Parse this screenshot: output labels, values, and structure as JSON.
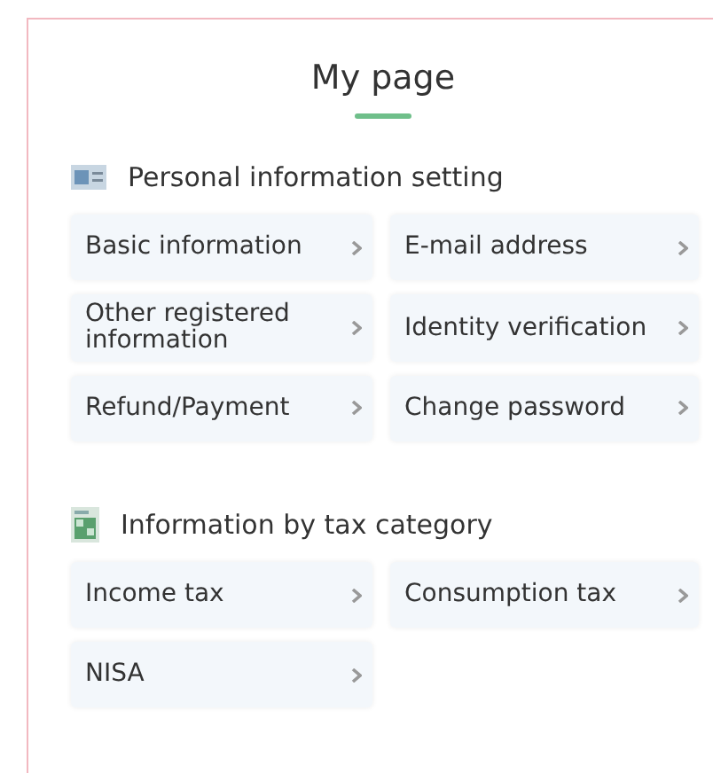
{
  "title": "My page",
  "sections": [
    {
      "kind": "profile",
      "heading": "Personal information setting",
      "links": [
        {
          "label": "Basic information"
        },
        {
          "label": "E-mail address"
        },
        {
          "label": "Other registered information"
        },
        {
          "label": "Identity verification"
        },
        {
          "label": "Refund/Payment"
        },
        {
          "label": "Change password"
        }
      ]
    },
    {
      "kind": "tax",
      "heading": "Information by tax category",
      "links": [
        {
          "label": "Income tax"
        },
        {
          "label": "Consumption tax"
        },
        {
          "label": "NISA"
        }
      ]
    }
  ]
}
